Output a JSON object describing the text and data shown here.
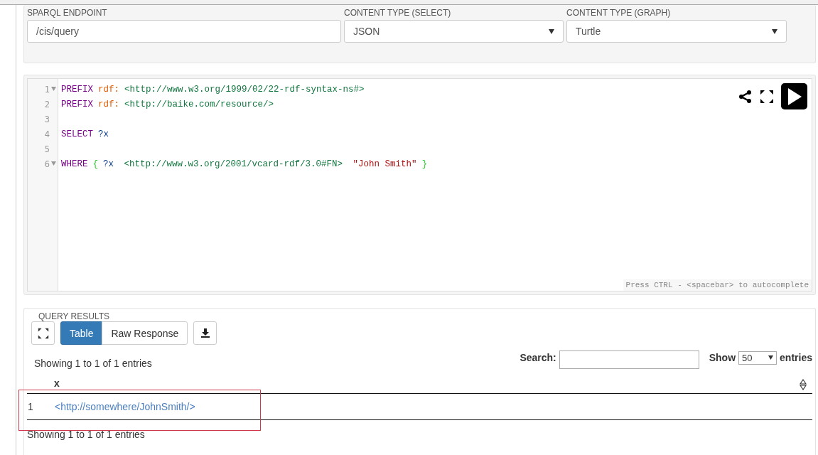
{
  "endpoint": {
    "label": "SPARQL ENDPOINT",
    "value": "/cis/query"
  },
  "content_type_select": {
    "label": "CONTENT TYPE (SELECT)",
    "value": "JSON"
  },
  "content_type_graph": {
    "label": "CONTENT TYPE (GRAPH)",
    "value": "Turtle"
  },
  "editor": {
    "lines": [
      {
        "number": "1",
        "foldable": true,
        "tokens": [
          {
            "kind": "keyword",
            "text": "PREFIX"
          },
          {
            "kind": "prefix",
            "text": "rdf:"
          },
          {
            "kind": "uri",
            "text": "<http://www.w3.org/1999/02/22-rdf-syntax-ns#>"
          }
        ]
      },
      {
        "number": "2",
        "foldable": false,
        "tokens": [
          {
            "kind": "keyword",
            "text": "PREFIX"
          },
          {
            "kind": "prefix",
            "text": "rdf:"
          },
          {
            "kind": "uri",
            "text": "<http://baike.com/resource/>"
          }
        ]
      },
      {
        "number": "3",
        "foldable": false
      },
      {
        "number": "4",
        "foldable": false,
        "tokens": [
          {
            "kind": "keyword",
            "text": "SELECT"
          },
          {
            "kind": "variable",
            "text": "?x"
          }
        ]
      },
      {
        "number": "5",
        "foldable": false
      },
      {
        "number": "6",
        "foldable": true,
        "tokens": [
          {
            "kind": "keyword",
            "text": "WHERE"
          },
          {
            "kind": "brace",
            "text": "{"
          },
          {
            "kind": "variable",
            "text": "?x"
          },
          {
            "kind": "uri",
            "text": " <http://www.w3.org/2001/vcard-rdf/3.0#FN>"
          },
          {
            "kind": "string",
            "text": " \"John Smith\""
          },
          {
            "kind": "brace",
            "text": "}"
          }
        ]
      }
    ],
    "hint": "Press CTRL - <spacebar> to autocomplete"
  },
  "results": {
    "title": "QUERY RESULTS",
    "tabs": [
      {
        "label": "Table",
        "selected": true
      },
      {
        "label": "Raw Response",
        "selected": false
      }
    ],
    "info_top": "Showing 1 to 1 of 1 entries",
    "search_label": "Search:",
    "show_label": "Show",
    "page_size": "50",
    "entries_label": "entries",
    "columns": [
      "x"
    ],
    "rows": [
      {
        "index": "1",
        "cells": [
          "<http://somewhere/JohnSmith/>"
        ]
      }
    ],
    "info_bottom": "Showing 1 to 1 of 1 entries"
  }
}
